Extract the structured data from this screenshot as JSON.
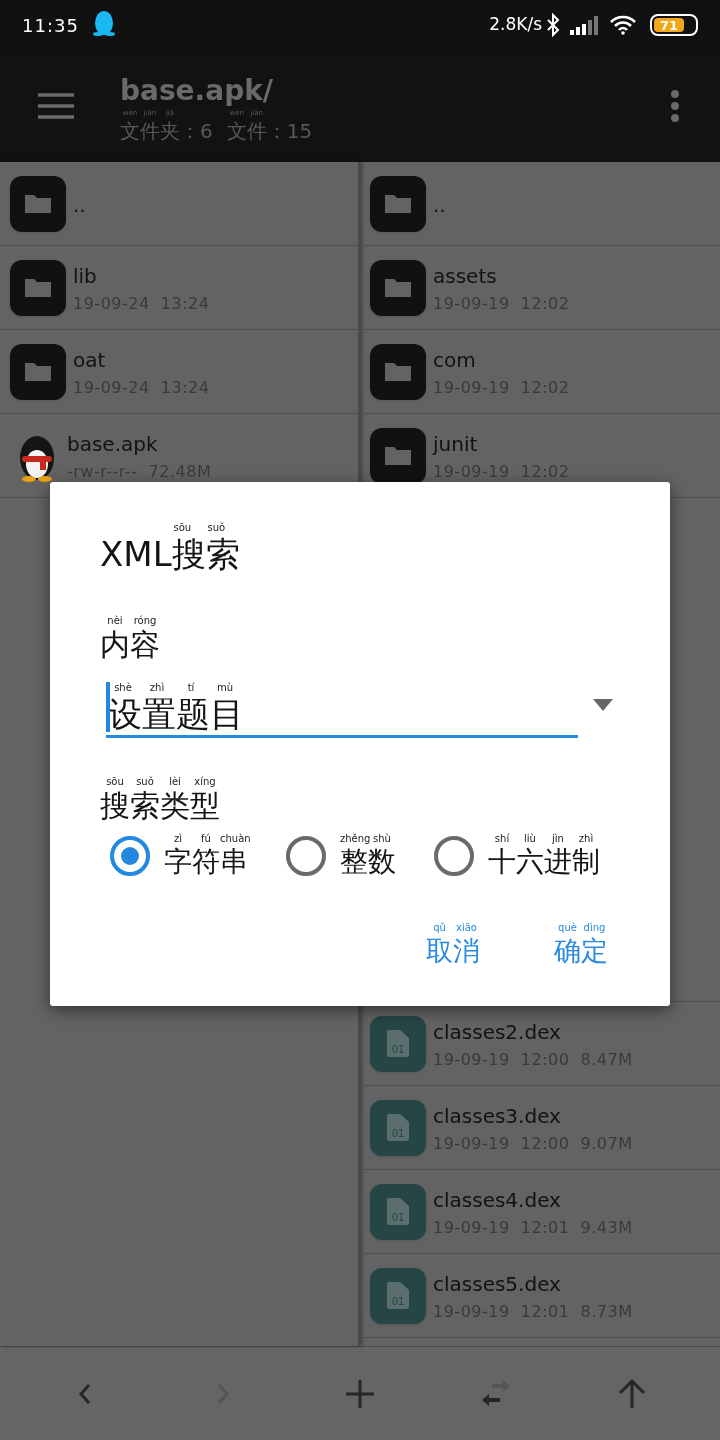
{
  "status_bar": {
    "time": "11:35",
    "net_speed": "2.8K/s",
    "battery": "71"
  },
  "toolbar": {
    "title": "base.apk/",
    "counts": [
      {
        "text": "文件夹：6",
        "pinyin": "wén jiàn jiā"
      },
      {
        "text": "文件：15",
        "pinyin": "wén jiàn"
      }
    ]
  },
  "left_pane": {
    "items": [
      {
        "kind": "folder",
        "name": ".."
      },
      {
        "kind": "folder",
        "name": "lib",
        "meta": "19-09-24 13:24"
      },
      {
        "kind": "folder",
        "name": "oat",
        "meta": "19-09-24 13:24"
      },
      {
        "kind": "apk",
        "name": "base.apk",
        "meta": "-rw-r--r-- 72.48M"
      }
    ]
  },
  "right_pane": {
    "items_above": [
      {
        "kind": "folder",
        "name": ".."
      },
      {
        "kind": "folder",
        "name": "assets",
        "meta": "19-09-19 12:02"
      },
      {
        "kind": "folder",
        "name": "com",
        "meta": "19-09-19 12:02"
      },
      {
        "kind": "folder",
        "name": "junit",
        "meta": "19-09-19 12:02"
      }
    ],
    "items_below": [
      {
        "kind": "dex",
        "name": "classes2.dex",
        "meta": "19-09-19 12:00 8.47M",
        "badge": "01"
      },
      {
        "kind": "dex",
        "name": "classes3.dex",
        "meta": "19-09-19 12:00 9.07M",
        "badge": "01"
      },
      {
        "kind": "dex",
        "name": "classes4.dex",
        "meta": "19-09-19 12:01 9.43M",
        "badge": "01"
      },
      {
        "kind": "dex",
        "name": "classes5.dex",
        "meta": "19-09-19 12:01 8.73M",
        "badge": "01"
      }
    ]
  },
  "dialog": {
    "title": {
      "text": "XML搜索",
      "pinyin": "sōu suǒ"
    },
    "content_label": {
      "text": "内容",
      "pinyin": "nèi róng"
    },
    "content_field": {
      "value": "设置题目",
      "pinyin": "shè zhì tí mù",
      "focused": true
    },
    "type_label": {
      "text": "搜索类型",
      "pinyin": "sōu suǒ lèi xíng"
    },
    "search_types": [
      {
        "label": "字符串",
        "pinyin": "zì fú chuàn",
        "selected": true
      },
      {
        "label": "整数",
        "pinyin": "zhěng shù",
        "selected": false
      },
      {
        "label": "十六进制",
        "pinyin": "shí liù jìn zhì",
        "selected": false
      }
    ],
    "buttons": [
      {
        "text": "取消",
        "pinyin": "qǔ xiāo"
      },
      {
        "text": "确定",
        "pinyin": "què dìng"
      }
    ]
  },
  "bottom_bar": [
    {
      "kind": "back",
      "disabled": false
    },
    {
      "kind": "forward",
      "disabled": true
    },
    {
      "kind": "add",
      "disabled": false
    },
    {
      "kind": "swap",
      "disabled": false
    },
    {
      "kind": "up",
      "disabled": false
    }
  ]
}
